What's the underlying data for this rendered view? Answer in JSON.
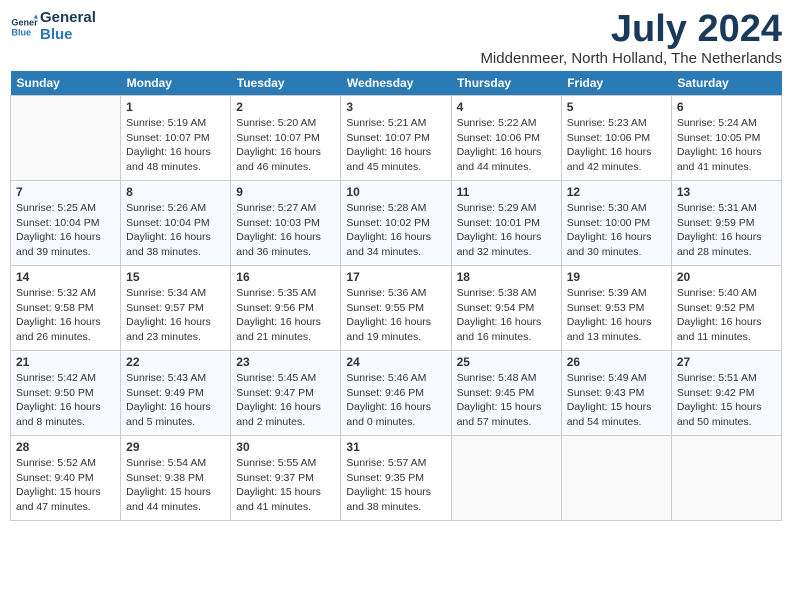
{
  "logo": {
    "line1": "General",
    "line2": "Blue"
  },
  "title": "July 2024",
  "location": "Middenmeer, North Holland, The Netherlands",
  "weekdays": [
    "Sunday",
    "Monday",
    "Tuesday",
    "Wednesday",
    "Thursday",
    "Friday",
    "Saturday"
  ],
  "weeks": [
    [
      {
        "day": "",
        "info": ""
      },
      {
        "day": "1",
        "info": "Sunrise: 5:19 AM\nSunset: 10:07 PM\nDaylight: 16 hours\nand 48 minutes."
      },
      {
        "day": "2",
        "info": "Sunrise: 5:20 AM\nSunset: 10:07 PM\nDaylight: 16 hours\nand 46 minutes."
      },
      {
        "day": "3",
        "info": "Sunrise: 5:21 AM\nSunset: 10:07 PM\nDaylight: 16 hours\nand 45 minutes."
      },
      {
        "day": "4",
        "info": "Sunrise: 5:22 AM\nSunset: 10:06 PM\nDaylight: 16 hours\nand 44 minutes."
      },
      {
        "day": "5",
        "info": "Sunrise: 5:23 AM\nSunset: 10:06 PM\nDaylight: 16 hours\nand 42 minutes."
      },
      {
        "day": "6",
        "info": "Sunrise: 5:24 AM\nSunset: 10:05 PM\nDaylight: 16 hours\nand 41 minutes."
      }
    ],
    [
      {
        "day": "7",
        "info": "Sunrise: 5:25 AM\nSunset: 10:04 PM\nDaylight: 16 hours\nand 39 minutes."
      },
      {
        "day": "8",
        "info": "Sunrise: 5:26 AM\nSunset: 10:04 PM\nDaylight: 16 hours\nand 38 minutes."
      },
      {
        "day": "9",
        "info": "Sunrise: 5:27 AM\nSunset: 10:03 PM\nDaylight: 16 hours\nand 36 minutes."
      },
      {
        "day": "10",
        "info": "Sunrise: 5:28 AM\nSunset: 10:02 PM\nDaylight: 16 hours\nand 34 minutes."
      },
      {
        "day": "11",
        "info": "Sunrise: 5:29 AM\nSunset: 10:01 PM\nDaylight: 16 hours\nand 32 minutes."
      },
      {
        "day": "12",
        "info": "Sunrise: 5:30 AM\nSunset: 10:00 PM\nDaylight: 16 hours\nand 30 minutes."
      },
      {
        "day": "13",
        "info": "Sunrise: 5:31 AM\nSunset: 9:59 PM\nDaylight: 16 hours\nand 28 minutes."
      }
    ],
    [
      {
        "day": "14",
        "info": "Sunrise: 5:32 AM\nSunset: 9:58 PM\nDaylight: 16 hours\nand 26 minutes."
      },
      {
        "day": "15",
        "info": "Sunrise: 5:34 AM\nSunset: 9:57 PM\nDaylight: 16 hours\nand 23 minutes."
      },
      {
        "day": "16",
        "info": "Sunrise: 5:35 AM\nSunset: 9:56 PM\nDaylight: 16 hours\nand 21 minutes."
      },
      {
        "day": "17",
        "info": "Sunrise: 5:36 AM\nSunset: 9:55 PM\nDaylight: 16 hours\nand 19 minutes."
      },
      {
        "day": "18",
        "info": "Sunrise: 5:38 AM\nSunset: 9:54 PM\nDaylight: 16 hours\nand 16 minutes."
      },
      {
        "day": "19",
        "info": "Sunrise: 5:39 AM\nSunset: 9:53 PM\nDaylight: 16 hours\nand 13 minutes."
      },
      {
        "day": "20",
        "info": "Sunrise: 5:40 AM\nSunset: 9:52 PM\nDaylight: 16 hours\nand 11 minutes."
      }
    ],
    [
      {
        "day": "21",
        "info": "Sunrise: 5:42 AM\nSunset: 9:50 PM\nDaylight: 16 hours\nand 8 minutes."
      },
      {
        "day": "22",
        "info": "Sunrise: 5:43 AM\nSunset: 9:49 PM\nDaylight: 16 hours\nand 5 minutes."
      },
      {
        "day": "23",
        "info": "Sunrise: 5:45 AM\nSunset: 9:47 PM\nDaylight: 16 hours\nand 2 minutes."
      },
      {
        "day": "24",
        "info": "Sunrise: 5:46 AM\nSunset: 9:46 PM\nDaylight: 16 hours\nand 0 minutes."
      },
      {
        "day": "25",
        "info": "Sunrise: 5:48 AM\nSunset: 9:45 PM\nDaylight: 15 hours\nand 57 minutes."
      },
      {
        "day": "26",
        "info": "Sunrise: 5:49 AM\nSunset: 9:43 PM\nDaylight: 15 hours\nand 54 minutes."
      },
      {
        "day": "27",
        "info": "Sunrise: 5:51 AM\nSunset: 9:42 PM\nDaylight: 15 hours\nand 50 minutes."
      }
    ],
    [
      {
        "day": "28",
        "info": "Sunrise: 5:52 AM\nSunset: 9:40 PM\nDaylight: 15 hours\nand 47 minutes."
      },
      {
        "day": "29",
        "info": "Sunrise: 5:54 AM\nSunset: 9:38 PM\nDaylight: 15 hours\nand 44 minutes."
      },
      {
        "day": "30",
        "info": "Sunrise: 5:55 AM\nSunset: 9:37 PM\nDaylight: 15 hours\nand 41 minutes."
      },
      {
        "day": "31",
        "info": "Sunrise: 5:57 AM\nSunset: 9:35 PM\nDaylight: 15 hours\nand 38 minutes."
      },
      {
        "day": "",
        "info": ""
      },
      {
        "day": "",
        "info": ""
      },
      {
        "day": "",
        "info": ""
      }
    ]
  ]
}
